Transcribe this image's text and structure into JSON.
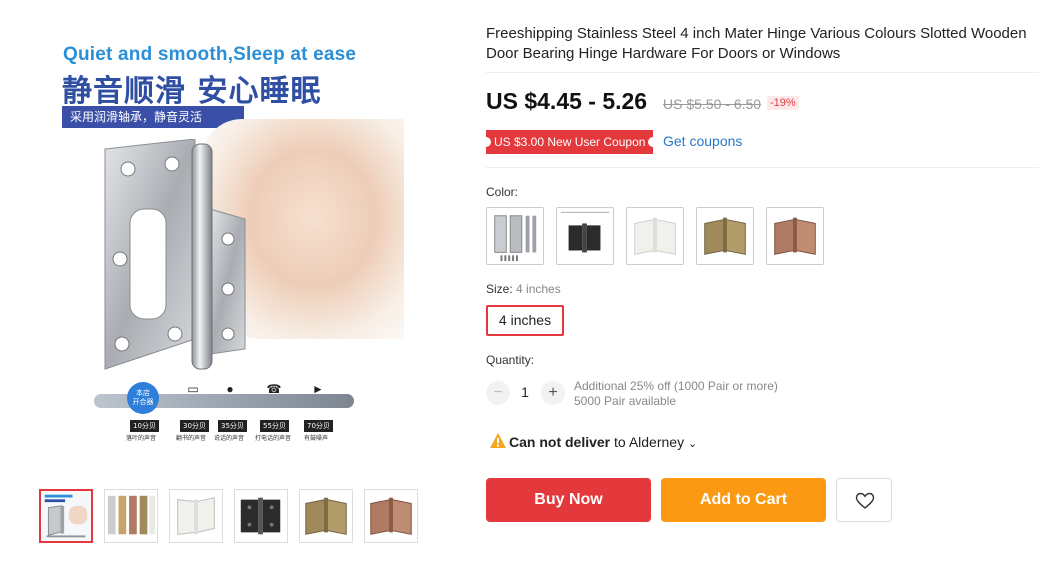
{
  "gallery": {
    "main": {
      "headline_en": "Quiet and smooth,Sleep at ease",
      "headline_cn": "静音顺滑 安心睡眠",
      "banner_cn": "采用润滑轴承，静音灵活",
      "knob_label": "本店\n开合器",
      "scale": [
        {
          "tag": "10分贝",
          "sub": "落叶的声音",
          "icon": "none"
        },
        {
          "tag": "30分贝",
          "sub": "翻书的声音",
          "icon": "book-icon"
        },
        {
          "tag": "35分贝",
          "sub": "说话的声音",
          "icon": "person-icon"
        },
        {
          "tag": "55分贝",
          "sub": "打电话的声音",
          "icon": "phone-icon"
        },
        {
          "tag": "70分贝",
          "sub": "有鼓噪声",
          "icon": "speaker-icon"
        }
      ]
    },
    "thumbs": [
      {
        "color": "stainless"
      },
      {
        "color": "multicolor"
      },
      {
        "color": "white"
      },
      {
        "color": "black"
      },
      {
        "color": "bronze"
      },
      {
        "color": "red-copper"
      }
    ]
  },
  "product": {
    "title": "Freeshipping Stainless Steel 4 inch Mater Hinge Various Colours Slotted Wooden Door Bearing Hinge Hardware For Doors or Windows",
    "price": "US $4.45 - 5.26",
    "old_price": "US $5.50 - 6.50",
    "discount": "-19%",
    "coupon": "US $3.00 New User Coupon",
    "get_coupons": "Get coupons"
  },
  "options": {
    "color_label": "Color:",
    "colors": [
      {
        "name": "stainless",
        "hex": "#b9bcc0"
      },
      {
        "name": "black",
        "hex": "#2b2b2b"
      },
      {
        "name": "white",
        "hex": "#f1f1ec"
      },
      {
        "name": "bronze",
        "hex": "#a08a5a"
      },
      {
        "name": "red-copper",
        "hex": "#b07b63"
      }
    ],
    "size_label": "Size:",
    "size_selected": "4 inches",
    "size_option": "4 inches",
    "quantity_label": "Quantity:",
    "quantity": "1",
    "minus": "−",
    "plus": "+",
    "qty_note_1": "Additional 25% off (1000 Pair or more)",
    "qty_note_2": "5000 Pair available"
  },
  "delivery": {
    "status": "Can not deliver",
    "to": "to Alderney",
    "chevron": "⌄"
  },
  "actions": {
    "buy_now": "Buy Now",
    "add_to_cart": "Add to Cart"
  },
  "colors": {
    "accent_red": "#e4393c",
    "accent_orange": "#fb9a12",
    "link_blue": "#2a78c6",
    "warning": "#f5a623"
  }
}
